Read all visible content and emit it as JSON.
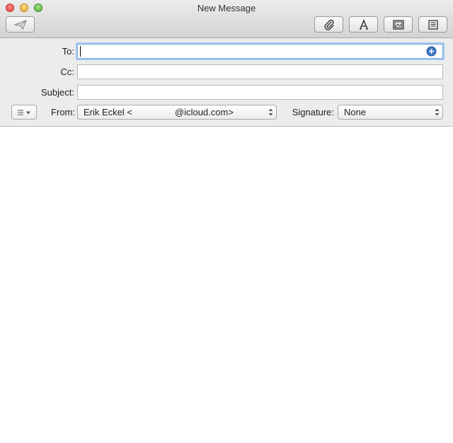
{
  "window": {
    "title": "New Message"
  },
  "toolbar": {
    "icons": [
      "send-icon",
      "attach-icon",
      "format-fonts-icon",
      "photo-browser-icon",
      "template-icon"
    ]
  },
  "headers": {
    "to_label": "To:",
    "to_value": "",
    "cc_label": "Cc:",
    "cc_value": "",
    "subject_label": "Subject:",
    "subject_value": "",
    "from_label": "From:",
    "from_value_prefix": "Erik Eckel <",
    "from_value_suffix": "@icloud.com>",
    "signature_label": "Signature:",
    "signature_value": "None"
  },
  "colors": {
    "focus_ring": "#a6c8f0",
    "add_contact": "#3d79c4"
  }
}
